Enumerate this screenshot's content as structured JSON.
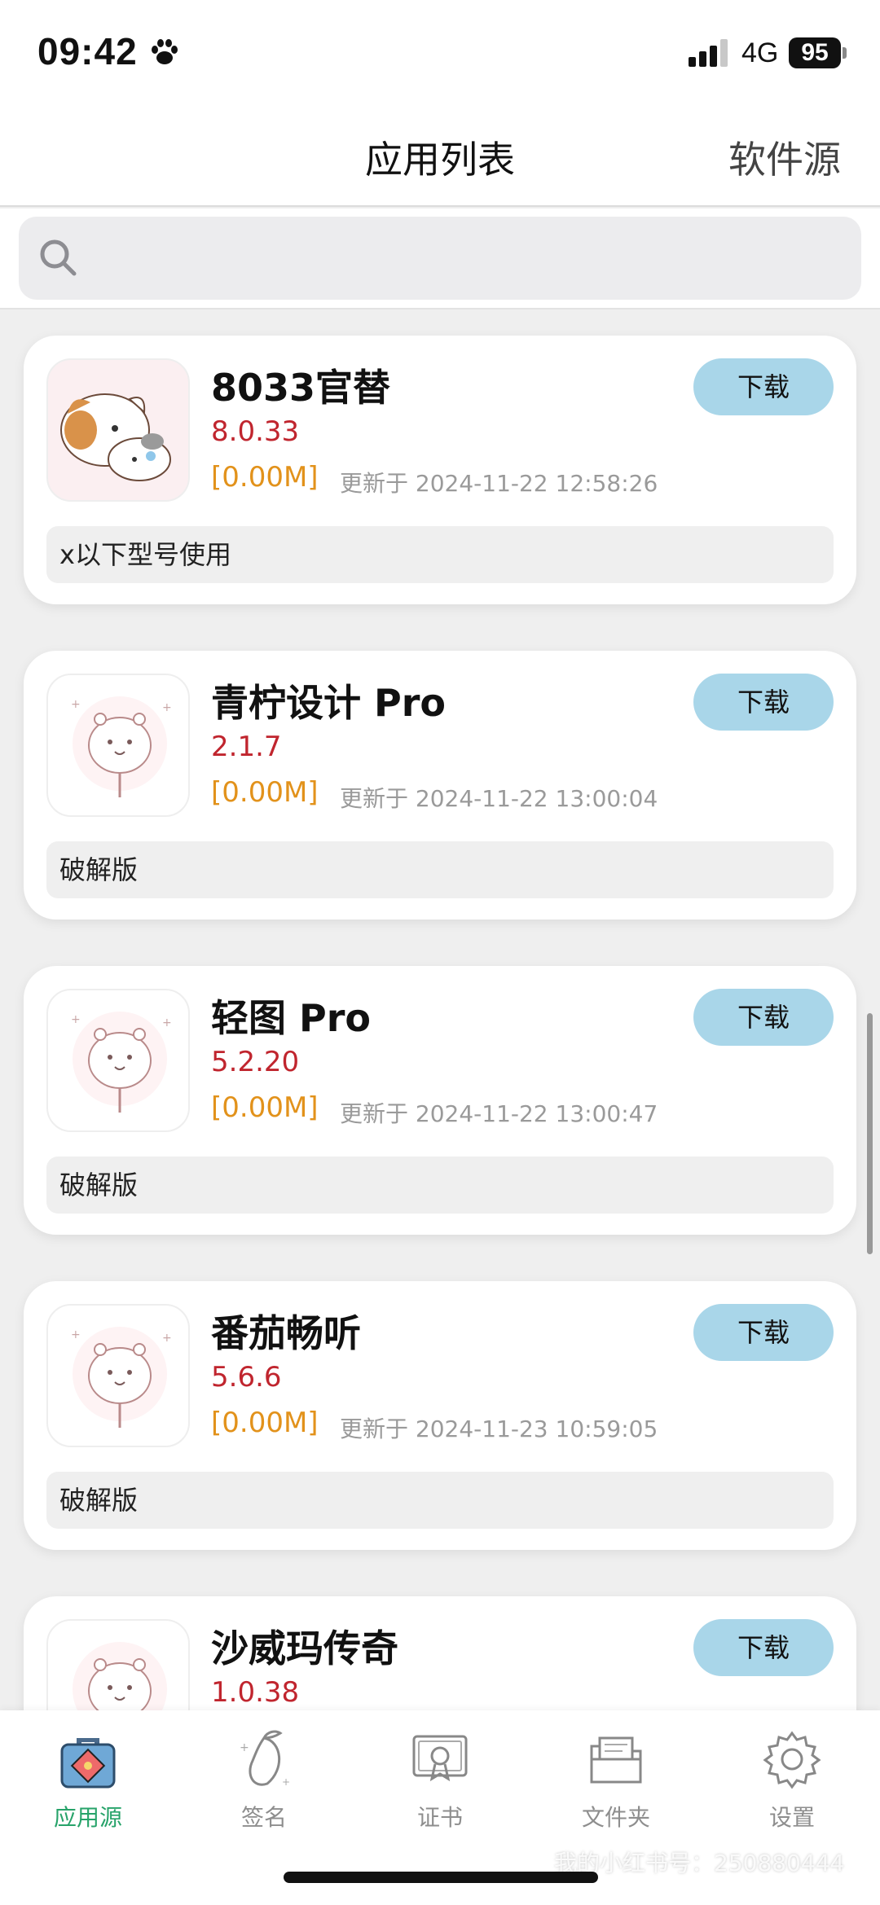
{
  "status_bar": {
    "time": "09:42",
    "network": "4G",
    "battery": "95"
  },
  "header": {
    "title": "应用列表",
    "right_action": "软件源"
  },
  "search": {
    "placeholder": ""
  },
  "apps": [
    {
      "name": "8033官替",
      "version": "8.0.33",
      "size": "[0.00M]",
      "updated": "更新于 2024-11-22 12:58:26",
      "note": "x以下型号使用",
      "download_label": "下载",
      "icon": "cat-mascot-icon"
    },
    {
      "name": "青柠设计 Pro",
      "version": "2.1.7",
      "size": "[0.00M]",
      "updated": "更新于 2024-11-22 13:00:04",
      "note": "破解版",
      "download_label": "下载",
      "icon": "hamster-mascot-icon"
    },
    {
      "name": "轻图 Pro",
      "version": "5.2.20",
      "size": "[0.00M]",
      "updated": "更新于 2024-11-22 13:00:47",
      "note": "破解版",
      "download_label": "下载",
      "icon": "hamster-mascot-icon"
    },
    {
      "name": "番茄畅听",
      "version": "5.6.6",
      "size": "[0.00M]",
      "updated": "更新于 2024-11-23 10:59:05",
      "note": "破解版",
      "download_label": "下载",
      "icon": "hamster-mascot-icon"
    },
    {
      "name": "沙威玛传奇",
      "version": "1.0.38",
      "size": "",
      "updated": "",
      "note": "",
      "download_label": "下载",
      "icon": "hamster-mascot-icon"
    }
  ],
  "tabs": [
    {
      "label": "应用源",
      "icon": "toolbox-icon",
      "active": true
    },
    {
      "label": "签名",
      "icon": "mango-icon",
      "active": false
    },
    {
      "label": "证书",
      "icon": "certificate-icon",
      "active": false
    },
    {
      "label": "文件夹",
      "icon": "folder-icon",
      "active": false
    },
    {
      "label": "设置",
      "icon": "gear-icon",
      "active": false
    }
  ],
  "watermark": "我的小红书号：250880444",
  "colors": {
    "accent": "#27a36a",
    "download_bg": "#a9d6e9",
    "version": "#c0252e",
    "size": "#e2921b"
  }
}
